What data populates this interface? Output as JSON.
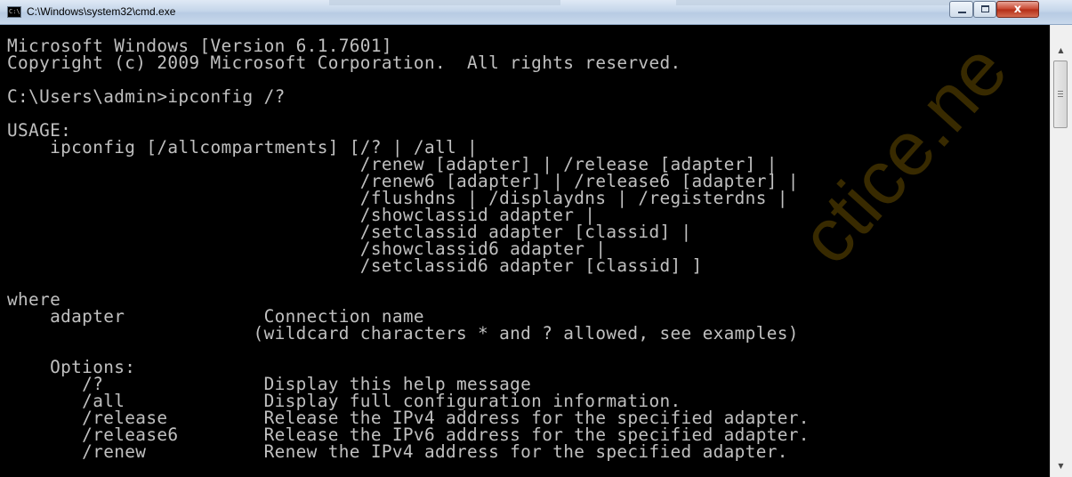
{
  "window": {
    "title": "C:\\Windows\\system32\\cmd.exe",
    "app_icon": "console-icon",
    "icon_text": "C:\\",
    "controls": {
      "minimize": "minimize-icon",
      "maximize": "maximize-icon",
      "close": "close-icon",
      "close_glyph": "x"
    }
  },
  "console": {
    "lines": [
      "Microsoft Windows [Version 6.1.7601]",
      "Copyright (c) 2009 Microsoft Corporation.  All rights reserved.",
      "",
      "C:\\Users\\admin>ipconfig /?",
      "",
      "USAGE:",
      "    ipconfig [/allcompartments] [/? | /all |",
      "                                 /renew [adapter] | /release [adapter] |",
      "                                 /renew6 [adapter] | /release6 [adapter] |",
      "                                 /flushdns | /displaydns | /registerdns |",
      "                                 /showclassid adapter |",
      "                                 /setclassid adapter [classid] |",
      "                                 /showclassid6 adapter |",
      "                                 /setclassid6 adapter [classid] ]",
      "",
      "where",
      "    adapter             Connection name",
      "                       (wildcard characters * and ? allowed, see examples)",
      "",
      "    Options:",
      "       /?               Display this help message",
      "       /all             Display full configuration information.",
      "       /release         Release the IPv4 address for the specified adapter.",
      "       /release6        Release the IPv6 address for the specified adapter.",
      "       /renew           Renew the IPv4 address for the specified adapter."
    ]
  },
  "scrollbar": {
    "up_icon": "scroll-up-arrow-icon",
    "down_icon": "scroll-down-arrow-icon",
    "position_fraction": 0.0
  },
  "watermark": {
    "text": "ctice.ne"
  }
}
